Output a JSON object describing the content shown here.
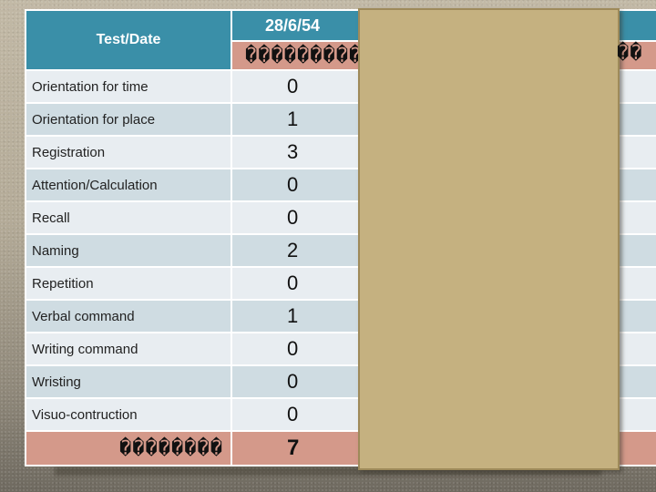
{
  "table": {
    "header_label": "Test/Date",
    "header_date": "28/6/54",
    "header_sub": "�������������������",
    "header_sub_overflow": "��",
    "rows": [
      {
        "label": "Orientation for time",
        "value": "0"
      },
      {
        "label": "Orientation for place",
        "value": "1"
      },
      {
        "label": "Registration",
        "value": "3"
      },
      {
        "label": "Attention/Calculation",
        "value": "0"
      },
      {
        "label": "Recall",
        "value": "0"
      },
      {
        "label": "Naming",
        "value": "2"
      },
      {
        "label": "Repetition",
        "value": "0"
      },
      {
        "label": "Verbal command",
        "value": "1"
      },
      {
        "label": "Writing command",
        "value": "0"
      },
      {
        "label": "Wristing",
        "value": "0"
      },
      {
        "label": "Visuo-contruction",
        "value": "0"
      }
    ],
    "total_label": "��������",
    "total_value": "7"
  },
  "colors": {
    "header_bg": "#3a8fa8",
    "accent_row_bg": "#d4998a",
    "row_light": "#e8edf1",
    "row_dark": "#cfdce2",
    "overlay_box": "#c5b180"
  }
}
